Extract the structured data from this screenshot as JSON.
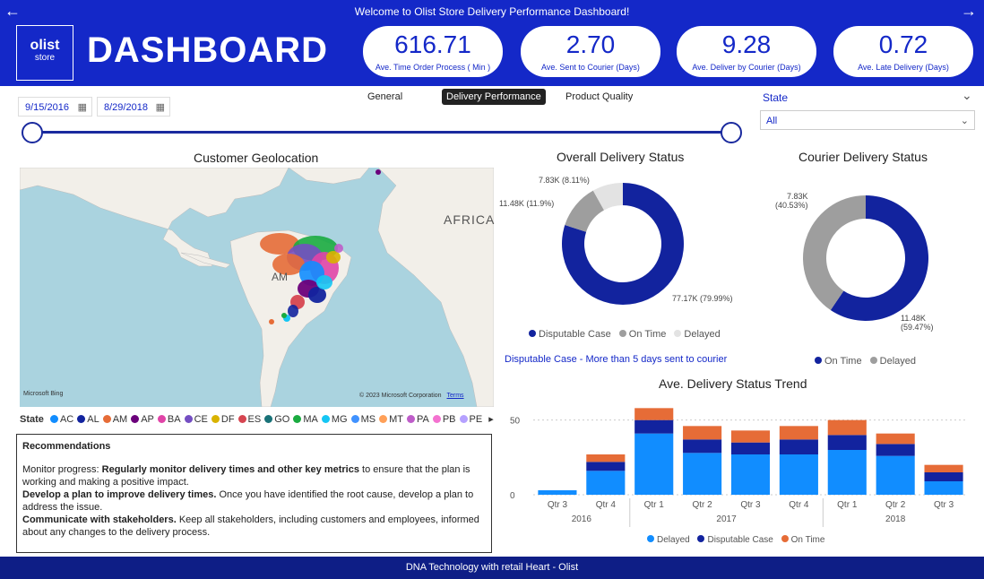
{
  "topbar": {
    "title": "Welcome to Olist Store Delivery Performance Dashboard!",
    "back_icon": "←",
    "forward_icon": "→"
  },
  "logo": {
    "line1": "olist",
    "line2": "store"
  },
  "header": {
    "title": "DASHBOARD"
  },
  "kpis": [
    {
      "value": "616.71",
      "label": "Ave. Time Order Process ( Min )"
    },
    {
      "value": "2.70",
      "label": "Ave. Sent to Courier (Days)"
    },
    {
      "value": "9.28",
      "label": "Ave. Deliver by Courier (Days)"
    },
    {
      "value": "0.72",
      "label": "Ave. Late Delivery (Days)"
    }
  ],
  "filters": {
    "start_date": "9/15/2016",
    "end_date": "8/29/2018",
    "calendar_icon": "▦"
  },
  "tabs": [
    {
      "label": "General",
      "active": false
    },
    {
      "label": "Delivery Performance",
      "active": true
    },
    {
      "label": "Product Quality",
      "active": false
    }
  ],
  "state_filter": {
    "label": "State",
    "value": "All",
    "chevron": "⌄"
  },
  "map": {
    "title": "Customer Geolocation",
    "africa_label": "AFRICA",
    "am_label": "AM",
    "bing": "Microsoft Bing",
    "credit": "© 2023 Microsoft Corporation",
    "terms": "Terms"
  },
  "state_legend": {
    "title": "State",
    "more_icon": "▸",
    "items": [
      {
        "code": "AC",
        "color": "#118dff"
      },
      {
        "code": "AL",
        "color": "#12239e"
      },
      {
        "code": "AM",
        "color": "#e66c37"
      },
      {
        "code": "AP",
        "color": "#6b007b"
      },
      {
        "code": "BA",
        "color": "#e044a7"
      },
      {
        "code": "CE",
        "color": "#744ec2"
      },
      {
        "code": "DF",
        "color": "#d9b300"
      },
      {
        "code": "ES",
        "color": "#d64550"
      },
      {
        "code": "GO",
        "color": "#197278"
      },
      {
        "code": "MA",
        "color": "#1aab40"
      },
      {
        "code": "MG",
        "color": "#15c6f4"
      },
      {
        "code": "MS",
        "color": "#4092ff"
      },
      {
        "code": "MT",
        "color": "#ffa058"
      },
      {
        "code": "PA",
        "color": "#be5dc9"
      },
      {
        "code": "PB",
        "color": "#f472d0"
      },
      {
        "code": "PE",
        "color": "#b5a1ff"
      }
    ]
  },
  "recommendations": {
    "title": "Recommendations",
    "p1_bold": "Regularly monitor delivery times and other key metrics",
    "p1_pre": "Monitor progress: ",
    "p1_post": " to ensure that the plan is working and making a positive impact.",
    "p2_bold": "Develop a plan to improve delivery times.",
    "p2_post": " Once you have identified the root cause, develop a plan to address the issue.",
    "p3_bold": "Communicate with stakeholders.",
    "p3_post": " Keep all stakeholders, including customers and employees, informed about any changes to the delivery process."
  },
  "overall_status": {
    "title": "Overall Delivery Status",
    "note": "Disputable Case - More than 5 days sent to courier"
  },
  "courier_status": {
    "title": "Courier Delivery Status"
  },
  "trend": {
    "title": "Ave. Delivery Status Trend"
  },
  "footer": {
    "text": "DNA Technology with retail Heart - Olist"
  },
  "chart_data": [
    {
      "type": "pie",
      "title": "Overall Delivery Status",
      "labels": [
        "Disputable Case",
        "On Time",
        "Delayed"
      ],
      "values": [
        77.17,
        11.48,
        7.83
      ],
      "value_labels": [
        "77.17K (79.99%)",
        "11.48K (11.9%)",
        "7.83K (8.11%)"
      ],
      "colors": [
        "#12239e",
        "#9e9e9e",
        "#e3e3e3"
      ],
      "legend": "bottom"
    },
    {
      "type": "pie",
      "title": "Courier Delivery Status",
      "labels": [
        "On Time",
        "Delayed"
      ],
      "values": [
        11.48,
        7.83
      ],
      "value_labels": [
        "11.48K (59.47%)",
        "7.83K (40.53%)"
      ],
      "colors": [
        "#12239e",
        "#9e9e9e"
      ],
      "legend": "bottom"
    },
    {
      "type": "bar",
      "stacked": true,
      "title": "Ave. Delivery Status Trend",
      "categories": [
        "Qtr 3",
        "Qtr 4",
        "Qtr 1",
        "Qtr 2",
        "Qtr 3",
        "Qtr 4",
        "Qtr 1",
        "Qtr 2",
        "Qtr 3"
      ],
      "years": [
        {
          "label": "2016",
          "from": 0,
          "to": 1
        },
        {
          "label": "2017",
          "from": 2,
          "to": 5
        },
        {
          "label": "2018",
          "from": 6,
          "to": 8
        }
      ],
      "series": [
        {
          "name": "Delayed",
          "color": "#118dff",
          "values": [
            3,
            16,
            41,
            28,
            27,
            27,
            30,
            26,
            9
          ]
        },
        {
          "name": "Disputable Case",
          "color": "#12239e",
          "values": [
            0,
            6,
            9,
            9,
            8,
            10,
            10,
            8,
            6
          ]
        },
        {
          "name": "On Time",
          "color": "#e66c37",
          "values": [
            0,
            5,
            8,
            9,
            8,
            9,
            10,
            7,
            5
          ]
        }
      ],
      "yticks": [
        0,
        50
      ],
      "ylim": [
        0,
        60
      ],
      "legend": "bottom"
    }
  ]
}
